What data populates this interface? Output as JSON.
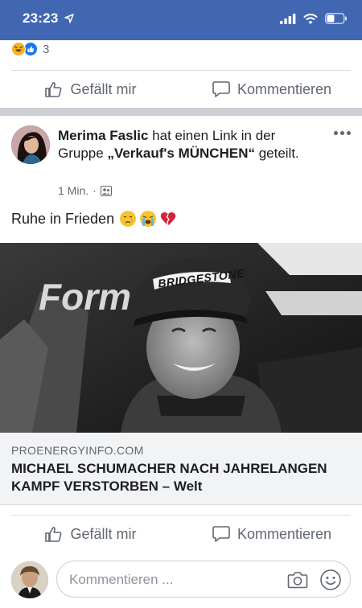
{
  "status_bar": {
    "time": "23:23"
  },
  "reactions": {
    "count": "3",
    "types": [
      "haha-icon",
      "like-icon"
    ]
  },
  "actions": {
    "like_label": "Gefällt mir",
    "comment_label": "Kommentieren"
  },
  "post": {
    "author": "Merima Faslic",
    "action_text": " hat einen Link in der Gruppe ",
    "group_name": "„Verkauf's MÜNCHEN“",
    "action_suffix": " geteilt.",
    "time": "1 Min.",
    "separator": "·",
    "audience_icon": "group-icon",
    "text": "Ruhe in Frieden",
    "emojis": [
      "crying-face",
      "loudly-crying-face",
      "broken-heart"
    ]
  },
  "link": {
    "domain": "PROENERGYINFO.COM",
    "title": "MICHAEL SCHUMACHER NACH JAHRELANGEN KAMPF VERSTORBEN – Welt",
    "image_texts": [
      "BRIDGESTONE",
      "Form"
    ]
  },
  "comment_box": {
    "placeholder": "Kommentieren ..."
  },
  "colors": {
    "header_blue": "#4267b2",
    "like_blue": "#1877f2",
    "haha_yellow": "#f7b125",
    "heart_red": "#d6223b",
    "text_gray": "#606770"
  }
}
